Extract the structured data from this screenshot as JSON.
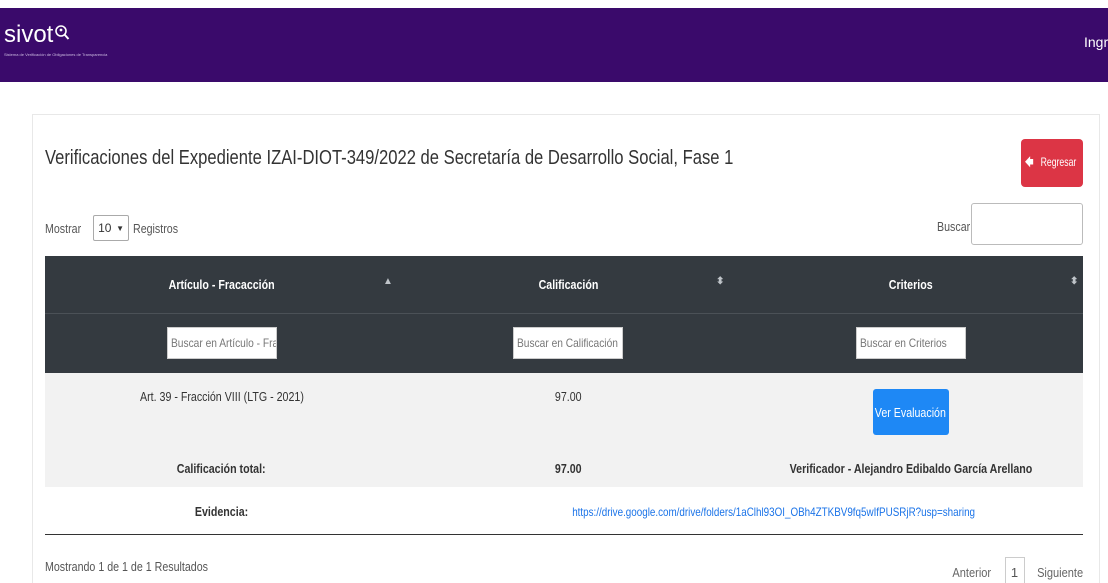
{
  "header": {
    "logo_text": "sivot",
    "logo_tagline": "Sistema de Verificación de Obligaciones de Transparencia",
    "login_label": "Ingresar",
    "bg_color": "#3a0a6b"
  },
  "page": {
    "title": "Verificaciones del Expediente IZAI-DIOT-349/2022 de Secretaría de Desarrollo Social, Fase 1",
    "back_button": "Regresar",
    "back_icon": "arrow-left-icon"
  },
  "controls": {
    "show_label": "Mostrar",
    "page_size": "10",
    "records_label": "Registros",
    "search_label": "Buscar:",
    "search_value": ""
  },
  "table": {
    "columns": [
      {
        "label": "Artículo - Fracacción",
        "sort": "asc"
      },
      {
        "label": "Calificación",
        "sort": "both"
      },
      {
        "label": "Criterios",
        "sort": "both"
      }
    ],
    "filters": [
      {
        "placeholder": "Buscar en Artículo - Fracacción"
      },
      {
        "placeholder": "Buscar en Calificación"
      },
      {
        "placeholder": "Buscar en Criterios"
      }
    ],
    "rows": [
      {
        "articulo": "Art. 39 - Fracción VIII (LTG - 2021)",
        "calificacion": "97.00",
        "action_label": "Ver Evaluación"
      }
    ],
    "total": {
      "label": "Calificación total:",
      "value": "97.00",
      "verifier": "Verificador - Alejandro Edibaldo García Arellano"
    },
    "evidence": {
      "label": "Evidencia:",
      "url": "https://drive.google.com/drive/folders/1aClhl93OI_OBh4ZTKBV9fq5wIfPUSRjR?usp=sharing"
    }
  },
  "footer": {
    "summary": "Mostrando 1 de 1 de 1 Resultados",
    "prev_label": "Anterior",
    "current_page": "1",
    "next_label": "Siguiente"
  }
}
